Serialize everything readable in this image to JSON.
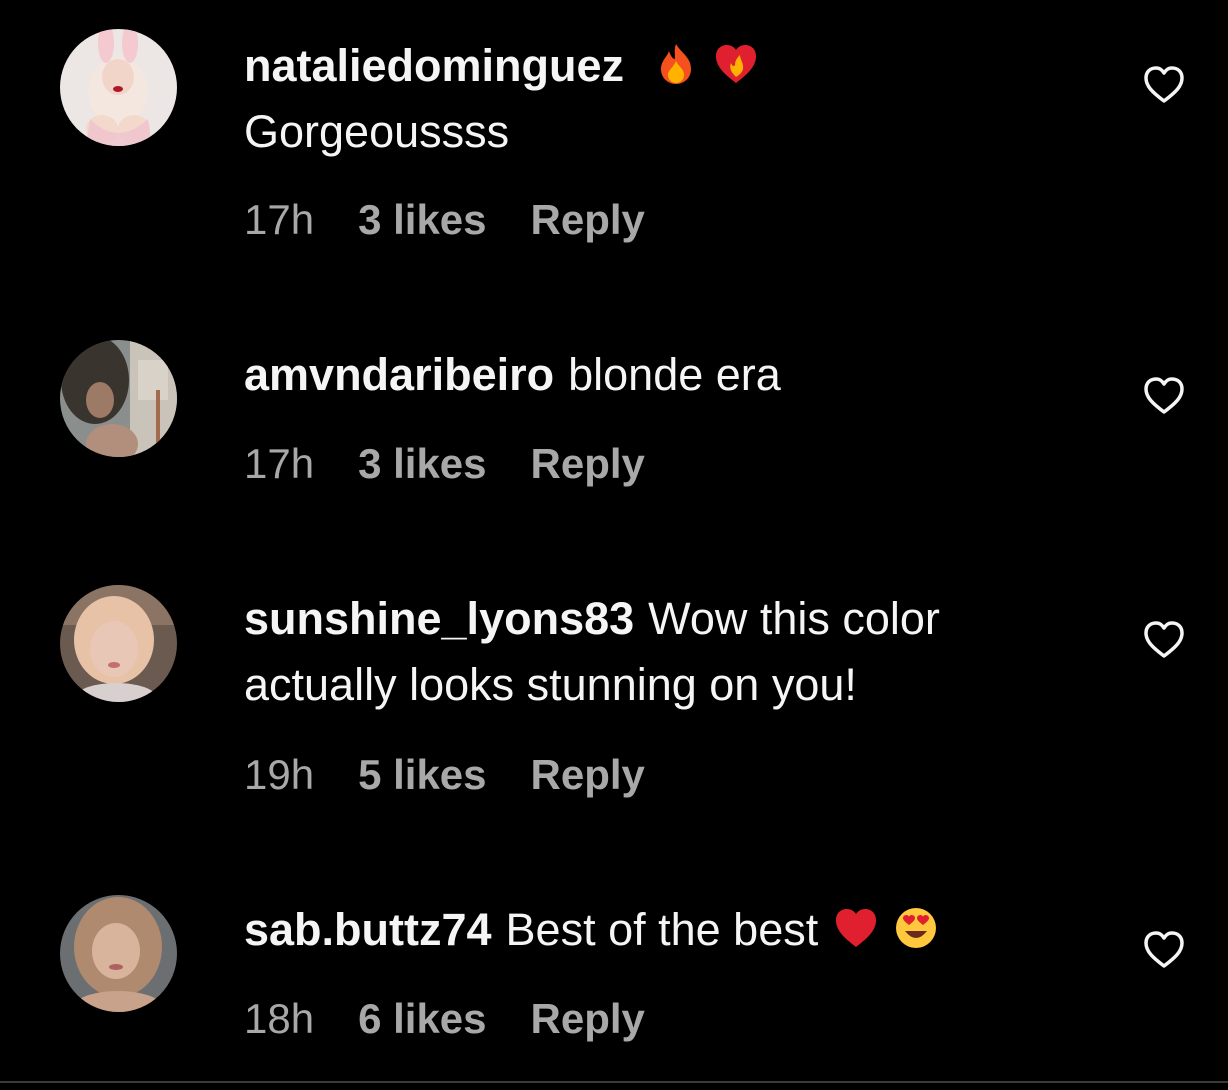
{
  "colors": {
    "background": "#000000",
    "text": "#f5f5f5",
    "secondary_text": "#a8a8a8"
  },
  "comments": [
    {
      "username": "nataliedominguez",
      "text": "Gorgeoussss",
      "emojis": [
        "fire-icon",
        "heart-on-fire-icon"
      ],
      "time": "17h",
      "likes": "3 likes",
      "reply": "Reply"
    },
    {
      "username": "amvndaribeiro",
      "text": "blonde era",
      "emojis": [],
      "time": "17h",
      "likes": "3 likes",
      "reply": "Reply"
    },
    {
      "username": "sunshine_lyons83",
      "text": "Wow this color actually looks stunning on you!",
      "emojis": [],
      "time": "19h",
      "likes": "5 likes",
      "reply": "Reply"
    },
    {
      "username": "sab.buttz74",
      "text": "Best of the best",
      "emojis": [
        "red-heart-icon",
        "heart-eyes-icon"
      ],
      "time": "18h",
      "likes": "6 likes",
      "reply": "Reply"
    }
  ]
}
